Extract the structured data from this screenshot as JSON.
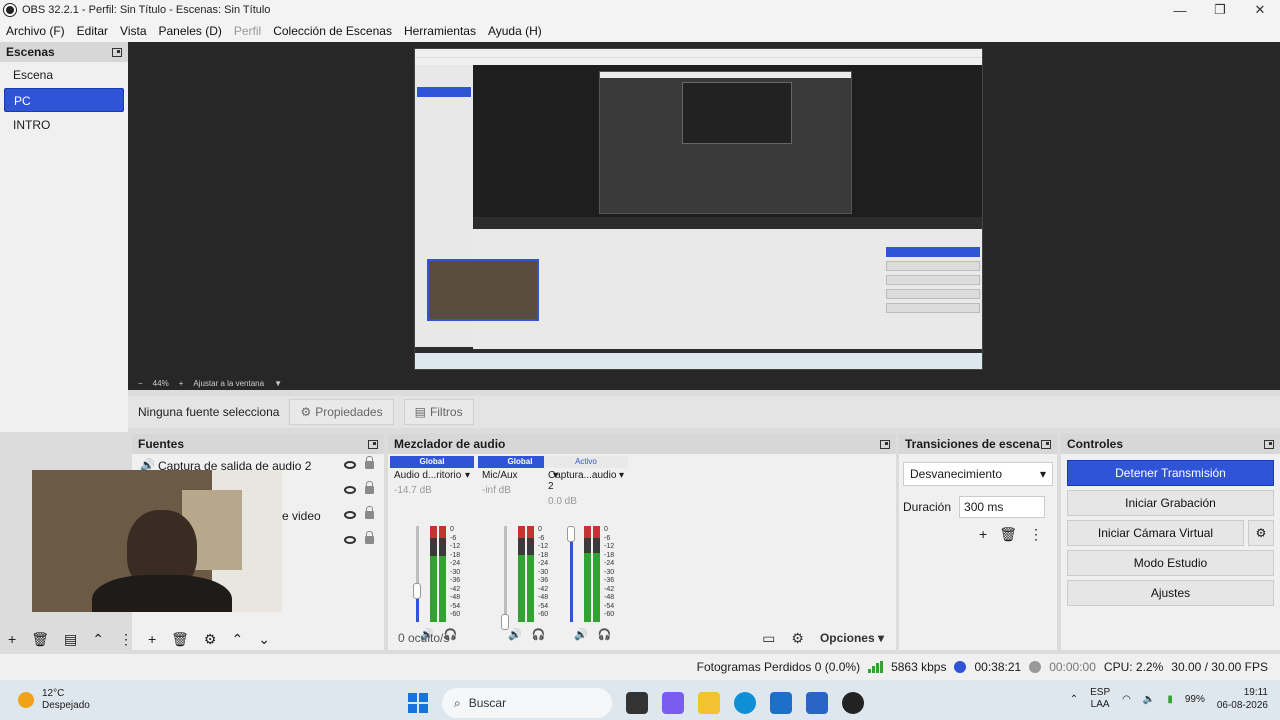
{
  "window": {
    "title": "OBS 32.2.1 - Perfil: Sin Título - Escenas: Sin Título",
    "min": "—",
    "max": "❐",
    "close": "✕"
  },
  "menu": [
    "Archivo (F)",
    "Editar",
    "Vista",
    "Paneles (D)",
    "Perfil",
    "Colección de Escenas",
    "Herramientas",
    "Ayuda (H)"
  ],
  "scenes": {
    "title": "Escenas",
    "items": [
      "Escena",
      "PC",
      "INTRO"
    ],
    "active": 1
  },
  "preview": {
    "zoom": "44%",
    "fit_label": "Ajustar a la ventana",
    "minus": "−",
    "plus": "+"
  },
  "source_bar": {
    "no_selection": "Ninguna fuente selecciona",
    "properties": "Propiedades",
    "filters": "Filtros"
  },
  "sources": {
    "title": "Fuentes",
    "items": [
      "Captura de salida de audio 2",
      "",
      "e video",
      ""
    ]
  },
  "mixer": {
    "title": "Mezclador de audio",
    "channels": [
      {
        "tag": "Global",
        "name": "Audio d...ritorio",
        "db": "-14.7 dB",
        "level": 0.78,
        "volume": 0.35
      },
      {
        "tag": "Global",
        "name": "Mic/Aux",
        "db": "-inf dB",
        "level": 0.8,
        "volume": 0.0
      },
      {
        "tag": "Activo",
        "name": "Captura...audio 2",
        "db": "0.0 dB",
        "level": 0.82,
        "volume": 1.0
      }
    ],
    "scale": [
      "0",
      "-6",
      "-12",
      "-18",
      "-24",
      "-30",
      "-36",
      "-42",
      "-48",
      "-54",
      "-60"
    ],
    "hidden": "0 oculto/s",
    "options": "Opciones"
  },
  "transitions": {
    "title": "Transiciones de escena",
    "type": "Desvanecimiento",
    "duration_label": "Duración",
    "duration": "300 ms"
  },
  "controls": {
    "title": "Controles",
    "stop_stream": "Detener Transmisión",
    "start_rec": "Iniciar Grabación",
    "virtual_cam": "Iniciar Cámara Virtual",
    "studio": "Modo Estudio",
    "settings": "Ajustes"
  },
  "status": {
    "dropped": "Fotogramas Perdidos 0 (0.0%)",
    "bitrate": "5863 kbps",
    "stream_time": "00:38:21",
    "rec_time": "00:00:00",
    "cpu": "CPU: 2.2%",
    "fps": "30.00 / 30.00 FPS"
  },
  "taskbar": {
    "temp": "12°C",
    "weather": "Despejado",
    "search": "Buscar",
    "lang1": "ESP",
    "lang2": "LAA",
    "battery": "99%",
    "time": "19:11",
    "date": "06-08-2026"
  },
  "colors": {
    "accent": "#2f54d6",
    "meter_green": "#31a331",
    "meter_red": "#c73232"
  }
}
